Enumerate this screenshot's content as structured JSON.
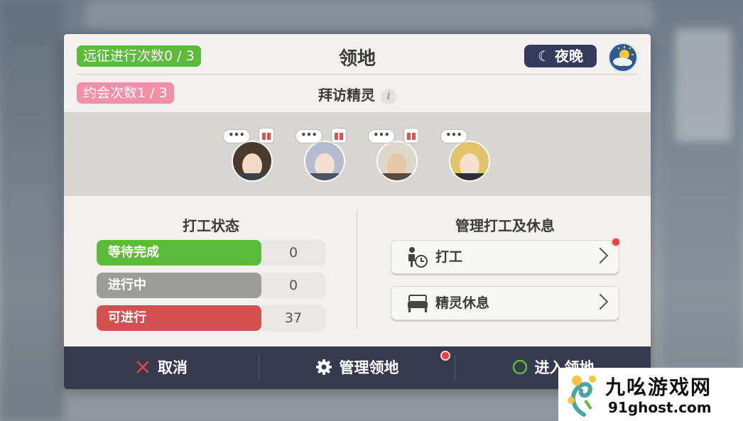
{
  "header": {
    "expedition_label": "远征进行次数0 / 3",
    "title": "领地",
    "time_of_day": "夜晚",
    "dating_label": "约会次数1 / 3",
    "visit_title": "拜访精灵",
    "info_glyph": "i"
  },
  "spirits": [
    {
      "bubble": "•••",
      "has_gift": true,
      "hair": "#4a3a2e",
      "skin": "#f1d9c6"
    },
    {
      "bubble": "•••",
      "has_gift": true,
      "hair": "#b5bccf",
      "skin": "#f4e0d3"
    },
    {
      "bubble": "•••",
      "has_gift": true,
      "hair": "#ded7cc",
      "skin": "#e8c6a8"
    },
    {
      "bubble": "•••",
      "has_gift": false,
      "hair": "#e1c36a",
      "skin": "#f6dfcc"
    }
  ],
  "work_status": {
    "title": "打工状态",
    "rows": [
      {
        "label": "等待完成",
        "value": "0",
        "color": "#5dbb3c"
      },
      {
        "label": "进行中",
        "value": "0",
        "color": "#9c9c9b"
      },
      {
        "label": "可进行",
        "value": "37",
        "color": "#d2504e"
      }
    ]
  },
  "manage": {
    "title": "管理打工及休息",
    "work_label": "打工",
    "rest_label": "精灵休息"
  },
  "footer": {
    "cancel_label": "取消",
    "manage_label": "管理领地",
    "enter_label": "进入领地"
  },
  "watermark": {
    "name": "九吆游戏网",
    "url": "91ghost.com"
  },
  "colors": {
    "panel": "#f2f1ef",
    "footer": "#353a4f",
    "badge_red": "#e8413b"
  }
}
